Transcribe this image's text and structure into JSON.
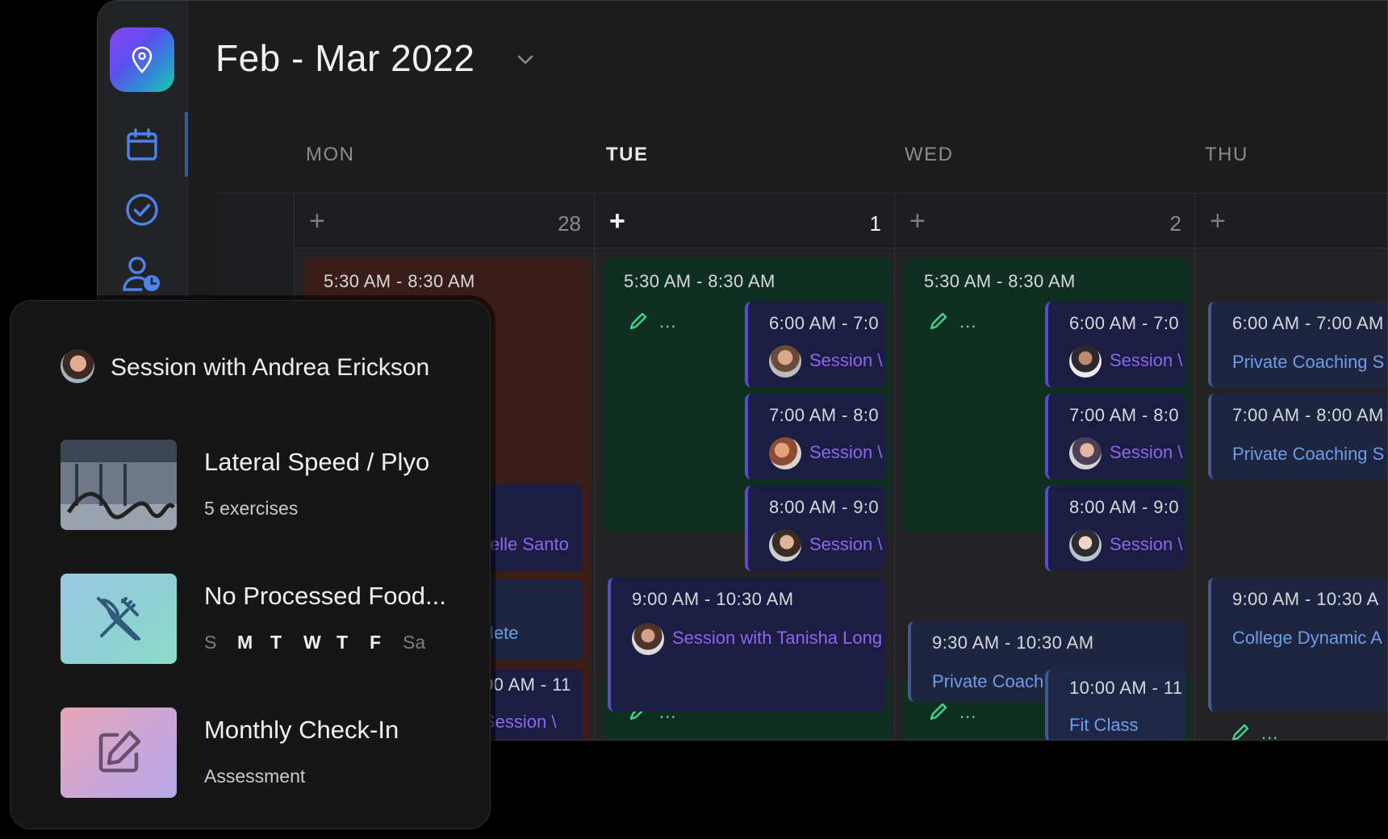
{
  "header": {
    "title": "Feb - Mar 2022"
  },
  "days": [
    {
      "label": "MON",
      "date": "28"
    },
    {
      "label": "TUE",
      "date": "1"
    },
    {
      "label": "WED",
      "date": "2"
    },
    {
      "label": "THU",
      "date": ""
    }
  ],
  "icons": {
    "logo": "location-pin-icon",
    "nav": [
      "calendar-icon",
      "check-circle-icon",
      "user-clock-icon"
    ]
  },
  "events": {
    "mon_block_time": "5:30 AM - 8:30 AM",
    "mon_partial_1": "elle Santo",
    "mon_partial_2": "lete",
    "mon_partial_3_time": "00 AM - 11",
    "mon_partial_3_sub": "Session \\",
    "tue_block_time": "5:30 AM - 8:30 AM",
    "tue_e1_time": "6:00 AM - 7:0",
    "tue_e1_sub": "Session \\",
    "tue_e2_time": "7:00 AM - 8:0",
    "tue_e2_sub": "Session \\",
    "tue_e3_time": "8:00 AM - 9:0",
    "tue_e3_sub": "Session \\",
    "tue_e4_time": "9:00 AM - 10:30 AM",
    "tue_e4_sub": "Session with Tanisha Long",
    "wed_block_time": "5:30 AM - 8:30 AM",
    "wed_e1_time": "6:00 AM - 7:0",
    "wed_e1_sub": "Session \\",
    "wed_e2_time": "7:00 AM - 8:0",
    "wed_e2_sub": "Session \\",
    "wed_e3_time": "8:00 AM - 9:0",
    "wed_e3_sub": "Session \\",
    "wed_e4_time": "9:30 AM - 10:30 AM",
    "wed_e4_sub": "Private Coach",
    "wed_e5_time": "10:00 AM - 11",
    "wed_e5_sub": "Fit Class",
    "thu_e1_time": "6:00 AM - 7:00 AM",
    "thu_e1_sub": "Private Coaching S",
    "thu_e2_time": "7:00 AM - 8:00 AM",
    "thu_e2_sub": "Private Coaching S",
    "thu_e3_time": "9:00 AM - 10:30 A",
    "thu_e3_sub": "College Dynamic A",
    "more_dots": "..."
  },
  "colors": {
    "accent_purple": "#8c67ee",
    "accent_blue": "#6f9ce6",
    "green_block": "#0f2f22",
    "red_block": "#3a1c18",
    "navy_event": "#1c1d42"
  },
  "card": {
    "title": "Session with Andrea Erickson",
    "items": [
      {
        "title": "Lateral Speed / Plyo",
        "sub": "5 exercises",
        "icon": "workout-photo"
      },
      {
        "title": "No Processed Food...",
        "icon": "fork-knife-crossed-icon",
        "weekdays": [
          "S",
          "M",
          "T",
          "W",
          "T",
          "F",
          "Sa"
        ]
      },
      {
        "title": "Monthly Check-In",
        "sub": "Assessment",
        "icon": "edit-icon"
      }
    ]
  }
}
